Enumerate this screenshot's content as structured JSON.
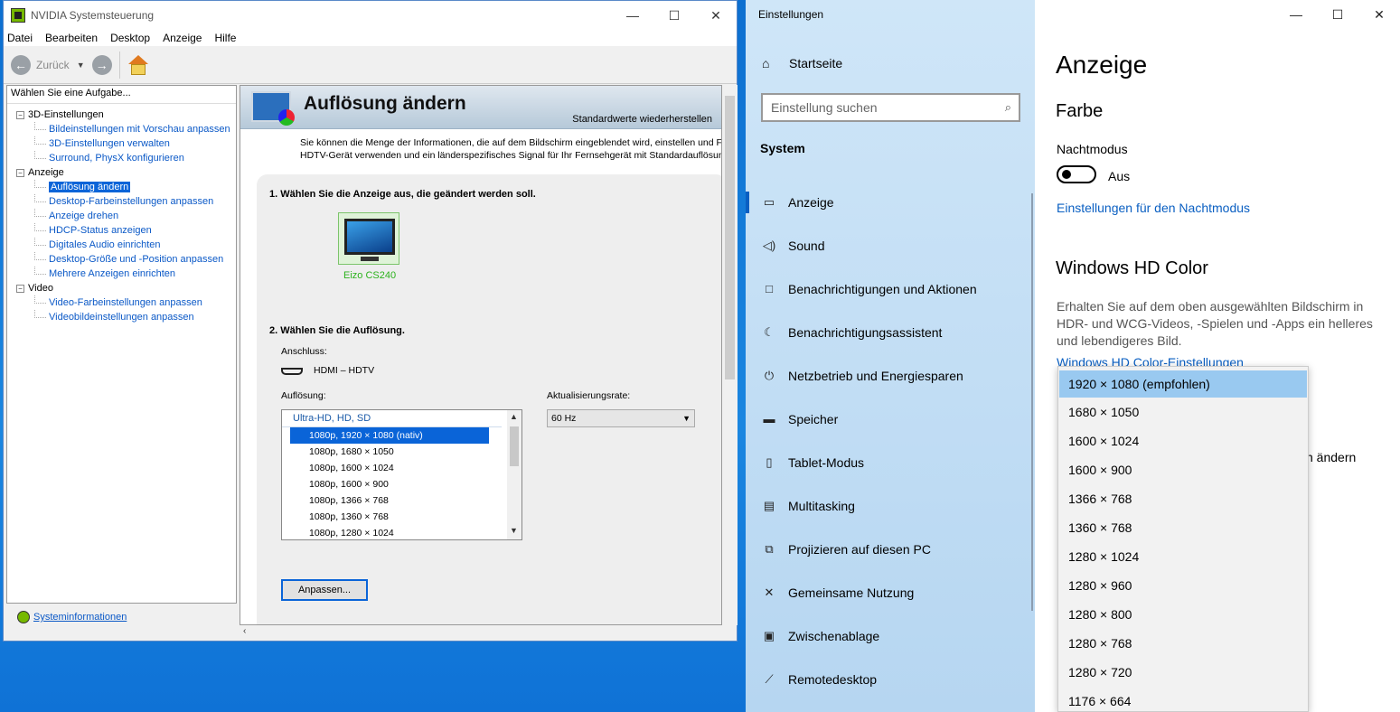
{
  "nvidia": {
    "title": "NVIDIA Systemsteuerung",
    "menu": [
      "Datei",
      "Bearbeiten",
      "Desktop",
      "Anzeige",
      "Hilfe"
    ],
    "toolbar": {
      "back_label": "Zurück"
    },
    "task_header": "Wählen Sie eine Aufgabe...",
    "tree": {
      "g1": "3D-Einstellungen",
      "g1_items": [
        "Bildeinstellungen mit Vorschau anpassen",
        "3D-Einstellungen verwalten",
        "Surround, PhysX konfigurieren"
      ],
      "g2": "Anzeige",
      "g2_items": [
        "Auflösung ändern",
        "Desktop-Farbeinstellungen anpassen",
        "Anzeige drehen",
        "HDCP-Status anzeigen",
        "Digitales Audio einrichten",
        "Desktop-Größe und -Position anpassen",
        "Mehrere Anzeigen einrichten"
      ],
      "g3": "Video",
      "g3_items": [
        "Video-Farbeinstellungen anpassen",
        "Videobildeinstellungen anpassen"
      ]
    },
    "sysinfo": "Systeminformationen",
    "page": {
      "title": "Auflösung ändern",
      "restore": "Standardwerte wiederherstellen",
      "desc1": "Sie können die Menge der Informationen, die auf dem Bildschirm eingeblendet wird, einstellen und F",
      "desc2": "HDTV-Gerät verwenden und ein länderspezifisches Signal für Ihr Fernsehgerät mit Standardauflösun",
      "step1": "1. Wählen Sie die Anzeige aus, die geändert werden soll.",
      "display_name": "Eizo CS240",
      "step2": "2. Wählen Sie die Auflösung.",
      "connector_label": "Anschluss:",
      "connector_value": "HDMI – HDTV",
      "resolution_label": "Auflösung:",
      "refresh_label": "Aktualisierungsrate:",
      "refresh_value": "60 Hz",
      "list_category": "Ultra-HD, HD, SD",
      "resolutions": [
        "1080p, 1920 × 1080 (nativ)",
        "1080p, 1680 × 1050",
        "1080p, 1600 × 1024",
        "1080p, 1600 × 900",
        "1080p, 1366 × 768",
        "1080p, 1360 × 768",
        "1080p, 1280 × 1024"
      ],
      "customize": "Anpassen..."
    }
  },
  "settings": {
    "title": "Einstellungen",
    "home": "Startseite",
    "search_placeholder": "Einstellung suchen",
    "section": "System",
    "nav": [
      "Anzeige",
      "Sound",
      "Benachrichtigungen und Aktionen",
      "Benachrichtigungsassistent",
      "Netzbetrieb und Energiesparen",
      "Speicher",
      "Tablet-Modus",
      "Multitasking",
      "Projizieren auf diesen PC",
      "Gemeinsame Nutzung",
      "Zwischenablage",
      "Remotedesktop"
    ],
    "nav_icons": [
      "monitor-icon",
      "speaker-icon",
      "message-icon",
      "moon-icon",
      "power-icon",
      "storage-icon",
      "tablet-icon",
      "multitasking-icon",
      "project-icon",
      "share-icon",
      "clipboard-icon",
      "remote-icon"
    ],
    "page_title": "Anzeige",
    "color_heading": "Farbe",
    "night_label": "Nachtmodus",
    "night_state": "Aus",
    "night_link": "Einstellungen für den Nachtmodus",
    "hd_heading": "Windows HD Color",
    "hd_desc": "Erhalten Sie auf dem oben ausgewählten Bildschirm in HDR- und WCG-Videos, -Spielen und -Apps ein helleres und lebendigeres Bild.",
    "hd_link": "Windows HD Color-Einstellungen",
    "partial_text": "n ändern",
    "resolution_options": [
      "1920 × 1080 (empfohlen)",
      "1680 × 1050",
      "1600 × 1024",
      "1600 × 900",
      "1366 × 768",
      "1360 × 768",
      "1280 × 1024",
      "1280 × 960",
      "1280 × 800",
      "1280 × 768",
      "1280 × 720",
      "1176 × 664"
    ]
  }
}
